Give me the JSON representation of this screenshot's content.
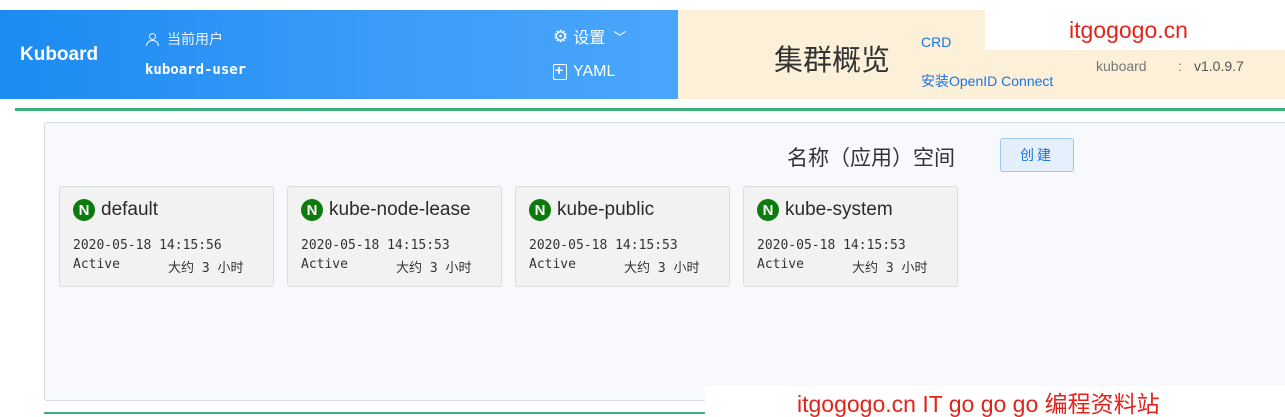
{
  "header": {
    "brand": "Kuboard",
    "user_label": "当前用户",
    "user_name": "kuboard-user",
    "settings_label": "设置",
    "yaml_label": "YAML",
    "page_title": "集群概览",
    "crd_link": "CRD",
    "openid_link": "安装OpenID Connect",
    "kuboard_label": "kuboard",
    "version_separator": ":",
    "version": "v1.0.9.7"
  },
  "namespaces": {
    "heading": "名称（应用）空间",
    "create_label": "创建",
    "items": [
      {
        "icon_letter": "N",
        "name": "default",
        "created": "2020-05-18 14:15:56",
        "status": "Active",
        "age": "大约 3 小时"
      },
      {
        "icon_letter": "N",
        "name": "kube-node-lease",
        "created": "2020-05-18 14:15:53",
        "status": "Active",
        "age": "大约 3 小时"
      },
      {
        "icon_letter": "N",
        "name": "kube-public",
        "created": "2020-05-18 14:15:53",
        "status": "Active",
        "age": "大约 3 小时"
      },
      {
        "icon_letter": "N",
        "name": "kube-system",
        "created": "2020-05-18 14:15:53",
        "status": "Active",
        "age": "大约 3 小时"
      }
    ]
  },
  "watermarks": {
    "top": "itgogogo.cn",
    "bottom": "itgogogo.cn IT go go go 编程资料站"
  },
  "colors": {
    "header_blue": "#1b8bf2",
    "title_panel_bg": "#fcf0d9",
    "accent_green": "#3cae7a",
    "namespace_icon_green": "#0c7a0c",
    "link_blue": "#1a73e8",
    "watermark_red": "#e3231b"
  },
  "icons": {
    "user": "user-icon",
    "settings": "gear-icon",
    "dropdown": "chevron-down-icon",
    "yaml": "file-plus-icon",
    "namespace": "namespace-icon"
  }
}
